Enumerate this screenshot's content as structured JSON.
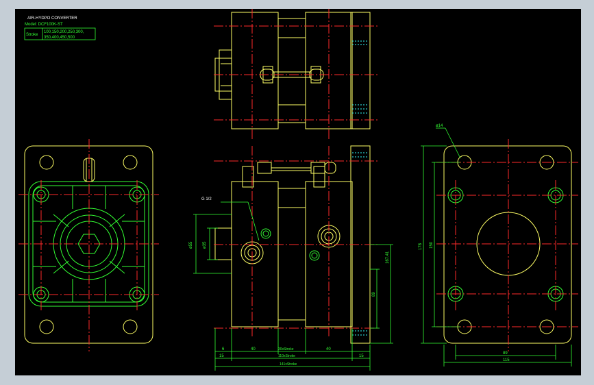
{
  "drawing": {
    "title": "AIR-HYDPO CONVERTER",
    "model_label": "Model: DCF100K-ST",
    "stroke_label": "Stroke",
    "stroke_values_1": "100,150,200,250,300,",
    "stroke_values_2": "350,400,450,500"
  },
  "dimensions": {
    "port_note": "G 1/2",
    "dia_55": "ø55",
    "dia_35": "ø35",
    "h_167": "167.41",
    "h_89": "89",
    "h_178": "178",
    "h_150": "150",
    "hole_dia": "ø14",
    "w_6": "6",
    "w_40a": "40",
    "w_30": "30xStroke",
    "w_40b": "40",
    "w_15a": "15",
    "w_110": "110xStroke",
    "w_15b": "15",
    "w_141": "141xStroke",
    "w_89": "89",
    "w_115": "115"
  },
  "colors": {
    "background": "#000000",
    "outline": "#ffff66",
    "detail": "#33ff33",
    "center": "#ff2a2a",
    "dim": "#33ff33",
    "hatch": "#33ffff",
    "frame": "#c5ced6"
  }
}
